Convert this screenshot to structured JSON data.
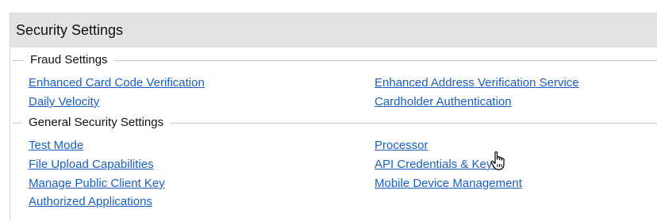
{
  "header": {
    "title": "Security Settings"
  },
  "fraud": {
    "legend": "Fraud Settings",
    "links": [
      "Enhanced Card Code Verification",
      "Enhanced Address Verification Service",
      "Daily Velocity",
      "Cardholder Authentication"
    ]
  },
  "general": {
    "legend": "General Security Settings",
    "links": [
      "Test Mode",
      "Processor",
      "File Upload Capabilities",
      "API Credentials & Keys",
      "Manage Public Client Key",
      "Mobile Device Management",
      "Authorized Applications"
    ]
  },
  "cursor": {
    "icon": "hand-pointer-icon"
  },
  "colors": {
    "link": "#1a5fbf",
    "header_bg": "#e3e3e3"
  }
}
